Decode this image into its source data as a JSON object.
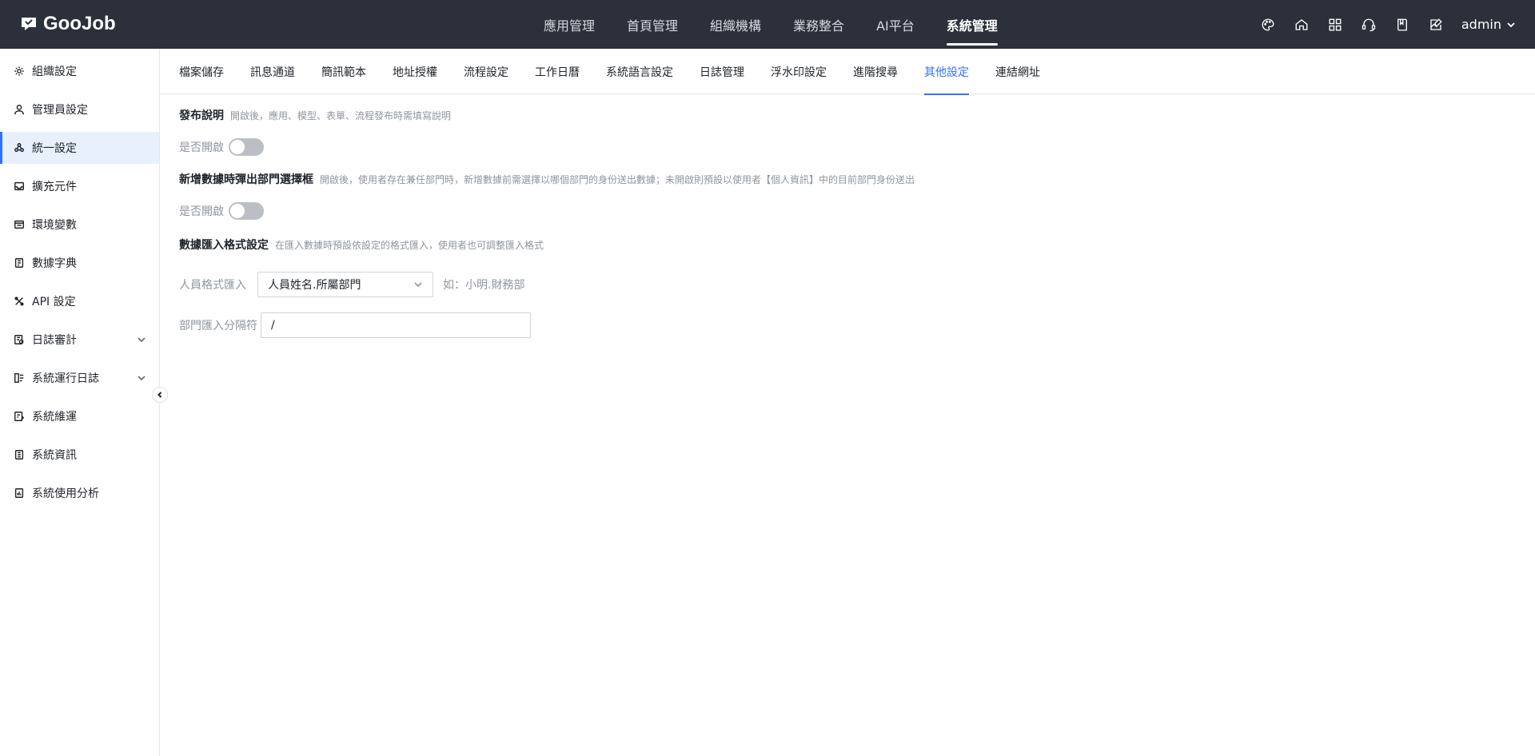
{
  "app": {
    "logo_text": "GooJob"
  },
  "topnav": {
    "items": [
      {
        "label": "應用管理"
      },
      {
        "label": "首頁管理"
      },
      {
        "label": "組織機構"
      },
      {
        "label": "業務整合"
      },
      {
        "label": "AI平台"
      },
      {
        "label": "系統管理"
      }
    ],
    "active_index": 5
  },
  "topbar": {
    "icons": [
      "palette-icon",
      "home-icon",
      "apps-grid-icon",
      "support-icon",
      "book-icon",
      "image-edit-icon"
    ],
    "user": "admin"
  },
  "sidebar": {
    "items": [
      {
        "label": "組織設定",
        "icon": "gear-icon"
      },
      {
        "label": "管理員設定",
        "icon": "user-icon"
      },
      {
        "label": "統一設定",
        "icon": "settings-cluster-icon"
      },
      {
        "label": "擴充元件",
        "icon": "inbox-icon"
      },
      {
        "label": "環境變數",
        "icon": "terminal-icon"
      },
      {
        "label": "數據字典",
        "icon": "dictionary-icon"
      },
      {
        "label": "API 設定",
        "icon": "api-icon"
      },
      {
        "label": "日誌審計",
        "icon": "audit-icon"
      },
      {
        "label": "系統運行日誌",
        "icon": "log-icon"
      },
      {
        "label": "系統維運",
        "icon": "maintenance-icon"
      },
      {
        "label": "系統資訊",
        "icon": "info-doc-icon"
      },
      {
        "label": "系統使用分析",
        "icon": "analysis-icon"
      }
    ],
    "active_index": 2
  },
  "tabs": {
    "items": [
      "檔案儲存",
      "訊息通道",
      "簡訊範本",
      "地址授權",
      "流程設定",
      "工作日曆",
      "系統語言設定",
      "日誌管理",
      "浮水印設定",
      "進階搜尋",
      "其他設定",
      "連結網址"
    ],
    "active_index": 10
  },
  "settings": {
    "publish": {
      "title": "發布說明",
      "desc": "開啟後，應用、模型、表單、流程發布時需填寫說明",
      "toggle_label": "是否開啟",
      "enabled": false
    },
    "dept_popup": {
      "title": "新增數據時彈出部門選擇框",
      "desc": "開啟後，使用者存在兼任部門時，新增數據前需選擇以哪個部門的身份送出數據；未開啟則預設以使用者【個人資訊】中的目前部門身份送出",
      "toggle_label": "是否開啟",
      "enabled": false
    },
    "import_format": {
      "title": "數據匯入格式設定",
      "desc": "在匯入數據時預設依設定的格式匯入，使用者也可調整匯入格式",
      "person_label": "人員格式匯入",
      "person_value": "人員姓名.所屬部門",
      "person_hint": "如：小明.財務部",
      "dept_sep_label": "部門匯入分隔符",
      "dept_sep_value": "/"
    }
  }
}
